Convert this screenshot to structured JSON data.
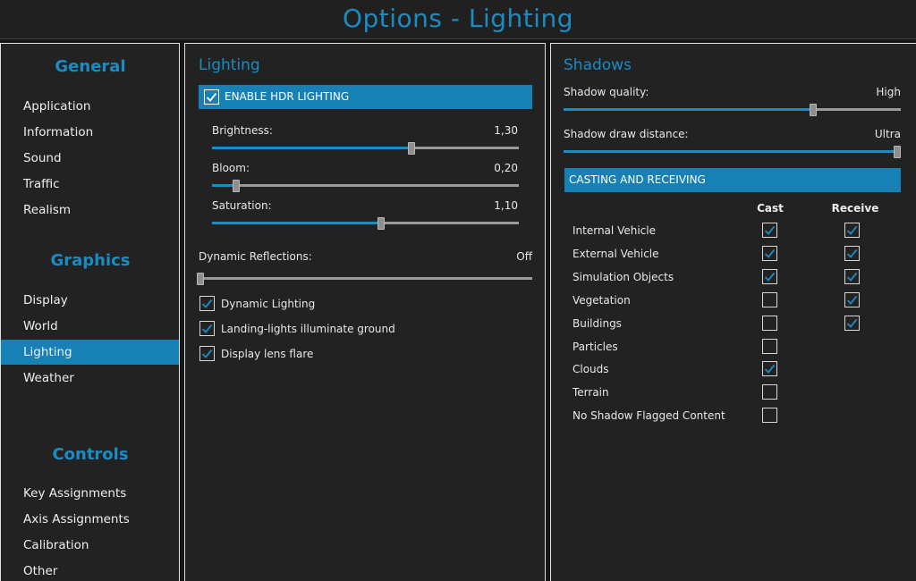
{
  "window": {
    "title": "Options - Lighting"
  },
  "sidebar": {
    "sections": [
      {
        "heading": "General",
        "items": [
          "Application",
          "Information",
          "Sound",
          "Traffic",
          "Realism"
        ]
      },
      {
        "heading": "Graphics",
        "items": [
          "Display",
          "World",
          "Lighting",
          "Weather"
        ]
      },
      {
        "heading": "Controls",
        "items": [
          "Key Assignments",
          "Axis Assignments",
          "Calibration",
          "Other"
        ]
      }
    ],
    "active_item": "Lighting"
  },
  "lighting": {
    "title": "Lighting",
    "hdr": {
      "label": "ENABLE HDR LIGHTING",
      "checked": true
    },
    "brightness": {
      "label": "Brightness:",
      "value": "1,30",
      "level": 0.65
    },
    "bloom": {
      "label": "Bloom:",
      "value": "0,20",
      "level": 0.08
    },
    "saturation": {
      "label": "Saturation:",
      "value": "1,10",
      "level": 0.55
    },
    "reflections": {
      "label": "Dynamic Reflections:",
      "value": "Off",
      "level": 0.0
    },
    "options": [
      {
        "label": "Dynamic Lighting",
        "checked": true
      },
      {
        "label": "Landing-lights illuminate ground",
        "checked": true
      },
      {
        "label": "Display lens flare",
        "checked": true
      }
    ]
  },
  "shadows": {
    "title": "Shadows",
    "quality": {
      "label": "Shadow quality:",
      "value": "High",
      "level": 0.74
    },
    "distance": {
      "label": "Shadow draw distance:",
      "value": "Ultra",
      "level": 1.0
    },
    "casting_header": "CASTING AND RECEIVING",
    "columns": {
      "cast": "Cast",
      "receive": "Receive"
    },
    "rows": [
      {
        "label": "Internal Vehicle",
        "cast": true,
        "receive": true
      },
      {
        "label": "External Vehicle",
        "cast": true,
        "receive": true
      },
      {
        "label": "Simulation Objects",
        "cast": true,
        "receive": true
      },
      {
        "label": "Vegetation",
        "cast": false,
        "receive": true
      },
      {
        "label": "Buildings",
        "cast": false,
        "receive": true
      },
      {
        "label": "Particles",
        "cast": false,
        "receive": null
      },
      {
        "label": "Clouds",
        "cast": true,
        "receive": null
      },
      {
        "label": "Terrain",
        "cast": false,
        "receive": null
      },
      {
        "label": "No Shadow Flagged Content",
        "cast": false,
        "receive": null
      }
    ]
  },
  "colors": {
    "accent": "#1781b6",
    "accent_text": "#1b8bc3",
    "background": "#222222"
  }
}
